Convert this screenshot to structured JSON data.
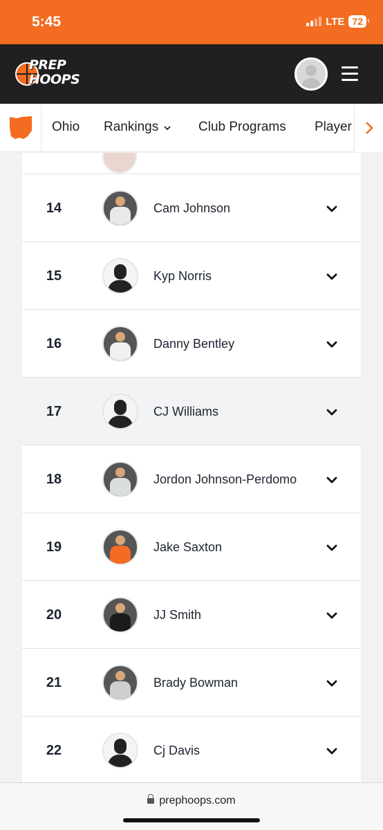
{
  "status_bar": {
    "time": "5:45",
    "network": "LTE",
    "battery": "72"
  },
  "header": {
    "logo_line1": "PREP",
    "logo_line2": "HOOPS"
  },
  "nav": {
    "state": "Ohio",
    "items": [
      {
        "label": "Ohio"
      },
      {
        "label": "Rankings"
      },
      {
        "label": "Club Programs"
      },
      {
        "label": "Player"
      }
    ]
  },
  "rankings": [
    {
      "rank": "14",
      "name": "Cam Johnson",
      "photo": "photo",
      "jersey": "#e9e9e9"
    },
    {
      "rank": "15",
      "name": "Kyp Norris",
      "photo": "placeholder"
    },
    {
      "rank": "16",
      "name": "Danny Bentley",
      "photo": "photo",
      "jersey": "#f0f0f0"
    },
    {
      "rank": "17",
      "name": "CJ Williams",
      "photo": "placeholder",
      "highlighted": true
    },
    {
      "rank": "18",
      "name": "Jordon Johnson-Perdomo",
      "photo": "photo",
      "jersey": "#d9dede"
    },
    {
      "rank": "19",
      "name": "Jake Saxton",
      "photo": "photo",
      "jersey": "#f36c21"
    },
    {
      "rank": "20",
      "name": "JJ Smith",
      "photo": "photo",
      "jersey": "#1b1b1b"
    },
    {
      "rank": "21",
      "name": "Brady Bowman",
      "photo": "photo",
      "jersey": "#cfcfcf"
    },
    {
      "rank": "22",
      "name": "Cj Davis",
      "photo": "placeholder"
    }
  ],
  "url_bar": {
    "url": "prephoops.com"
  },
  "colors": {
    "brand_orange": "#f36c21",
    "header_dark": "#202020"
  }
}
